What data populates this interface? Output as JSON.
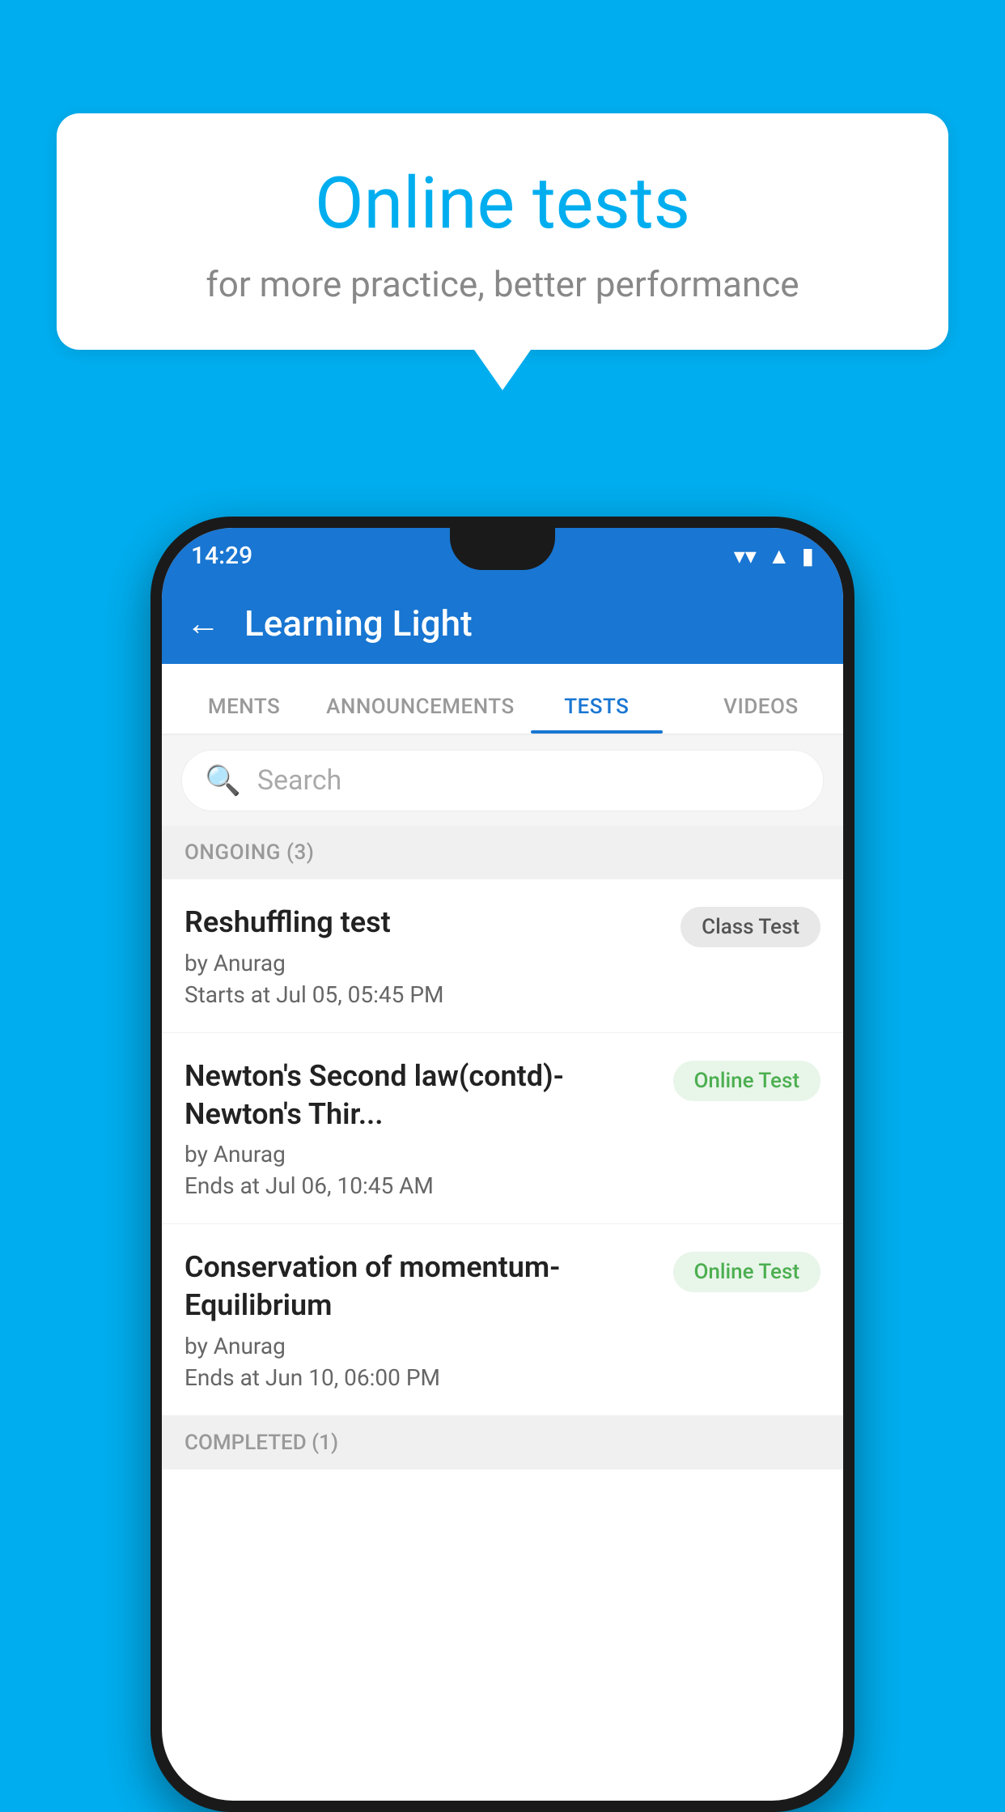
{
  "background": {
    "color": "#00AEEF"
  },
  "speech_bubble": {
    "title": "Online tests",
    "subtitle": "for more practice, better performance"
  },
  "phone": {
    "status_bar": {
      "time": "14:29",
      "wifi_icon": "▼",
      "signal_icon": "▲",
      "battery_icon": "▮"
    },
    "top_bar": {
      "back_label": "←",
      "title": "Learning Light"
    },
    "tabs": [
      {
        "label": "MENTS",
        "active": false
      },
      {
        "label": "ANNOUNCEMENTS",
        "active": false
      },
      {
        "label": "TESTS",
        "active": true
      },
      {
        "label": "VIDEOS",
        "active": false
      }
    ],
    "search": {
      "placeholder": "Search",
      "icon": "🔍"
    },
    "ongoing_section": {
      "title": "ONGOING (3)"
    },
    "tests": [
      {
        "name": "Reshuffling test",
        "author": "by Anurag",
        "time_label": "Starts at",
        "time": "Jul 05, 05:45 PM",
        "badge": "Class Test",
        "badge_type": "class"
      },
      {
        "name": "Newton's Second law(contd)-Newton's Thir...",
        "author": "by Anurag",
        "time_label": "Ends at",
        "time": "Jul 06, 10:45 AM",
        "badge": "Online Test",
        "badge_type": "online"
      },
      {
        "name": "Conservation of momentum-Equilibrium",
        "author": "by Anurag",
        "time_label": "Ends at",
        "time": "Jun 10, 06:00 PM",
        "badge": "Online Test",
        "badge_type": "online"
      }
    ],
    "completed_section": {
      "title": "COMPLETED (1)"
    }
  }
}
